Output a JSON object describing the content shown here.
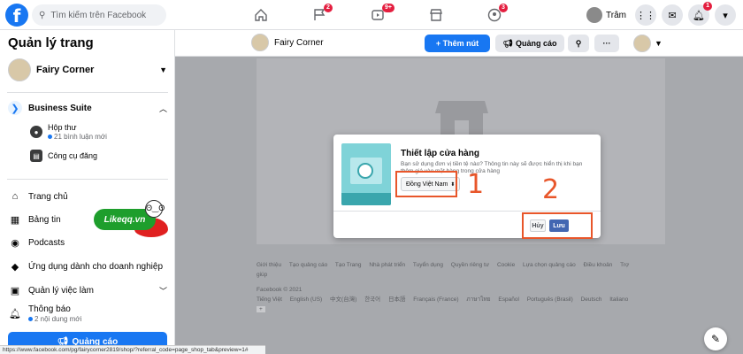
{
  "topbar": {
    "logo": "f",
    "search_placeholder": "Tìm kiếm trên Facebook",
    "nav": [
      {
        "icon": "home-icon",
        "badge": ""
      },
      {
        "icon": "flag-icon",
        "badge": "2"
      },
      {
        "icon": "watch-icon",
        "badge": "9+"
      },
      {
        "icon": "marketplace-icon",
        "badge": ""
      },
      {
        "icon": "groups-icon",
        "badge": "3"
      }
    ],
    "profile_name": "Trâm",
    "notif_badge": "1"
  },
  "sidebar": {
    "title": "Quản lý trang",
    "page_name": "Fairy Corner",
    "business_suite": "Business Suite",
    "inbox_label": "Hộp thư",
    "inbox_sub": "21 bình luận mới",
    "publishing_tools": "Công cụ đăng",
    "items": [
      "Trang chủ",
      "Bảng tin",
      "Podcasts",
      "Ứng dụng dành cho doanh nghiệp",
      "Quản lý việc làm"
    ],
    "notifications": "Thông báo",
    "notifications_sub": "2 nội dung mới",
    "ads_button": "Quảng cáo",
    "watermark": "Likeqq.vn"
  },
  "main_header": {
    "page_name": "Fairy Corner",
    "add_button": "+ Thêm nút",
    "ads_button": "Quảng cáo",
    "more": "···"
  },
  "modal": {
    "title": "Thiết lập cửa hàng",
    "description": "Bạn sử dụng đơn vị tiền tệ nào? Thông tin này sẽ được hiển thị khi bạn thêm giá vào mặt hàng trong cửa hàng",
    "currency_value": "Đồng Việt Nam",
    "cancel": "Hủy",
    "save": "Lưu"
  },
  "annotations": {
    "one": "1",
    "two": "2"
  },
  "footer": {
    "links": [
      "Giới thiệu",
      "Tạo quảng cáo",
      "Tạo Trang",
      "Nhà phát triển",
      "Tuyển dụng",
      "Quyền riêng tư",
      "Cookie",
      "Lựa chọn quảng cáo",
      "Điều khoản",
      "Trợ giúp"
    ],
    "copyright": "Facebook © 2021",
    "languages": [
      "Tiếng Việt",
      "English (US)",
      "中文(台灣)",
      "한국어",
      "日本語",
      "Français (France)",
      "ภาษาไทย",
      "Español",
      "Português (Brasil)",
      "Deutsch",
      "Italiano"
    ]
  },
  "status_url": "https://www.facebook.com/pg/fairycorner2819/shop/?referral_code=page_shop_tab&preview=1#"
}
